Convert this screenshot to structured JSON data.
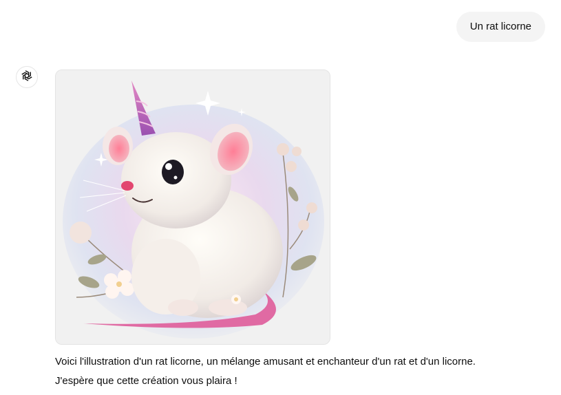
{
  "user_message": {
    "text": "Un rat licorne"
  },
  "assistant": {
    "avatar_icon": "openai-logo-icon",
    "image": {
      "subject": "rat-unicorn-illustration"
    },
    "paragraphs": [
      "Voici l'illustration d'un rat licorne, un mélange amusant et enchanteur d'un rat et d'un licorne.",
      "J'espère que cette création vous plaira !"
    ]
  },
  "colors": {
    "user_bubble_bg": "#f4f4f4",
    "text": "#0d0d0d",
    "image_bg": "#f1f1f1"
  }
}
